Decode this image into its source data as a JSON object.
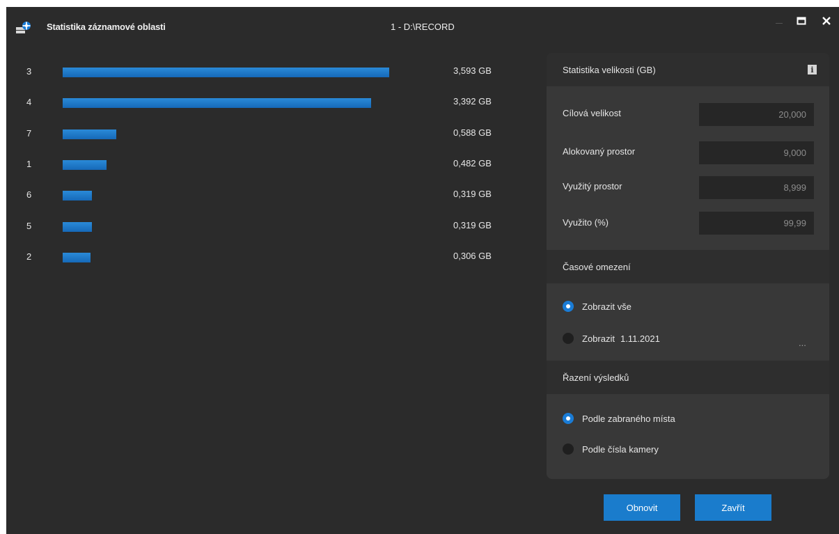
{
  "window": {
    "title": "Statistika záznamové oblasti",
    "subtitle": "1 - D:\\RECORD",
    "icons": [
      "app-icon",
      "minimize-icon",
      "maximize-icon",
      "close-icon"
    ]
  },
  "chart_data": {
    "type": "bar",
    "orientation": "horizontal",
    "categories": [
      "3",
      "4",
      "7",
      "1",
      "6",
      "5",
      "2"
    ],
    "values": [
      3.593,
      3.392,
      0.588,
      0.482,
      0.319,
      0.319,
      0.306
    ],
    "value_labels": [
      "3,593 GB",
      "3,392 GB",
      "0,588 GB",
      "0,482 GB",
      "0,319 GB",
      "0,319 GB",
      "0,306 GB"
    ],
    "unit": "GB",
    "bar_color": "#1a75c8"
  },
  "stats": {
    "header": "Statistika velikosti (GB)",
    "fields": [
      {
        "label": "Cílová velikost",
        "value": "20,000"
      },
      {
        "label": "Alokovaný prostor",
        "value": "9,000"
      },
      {
        "label": "Využitý prostor",
        "value": "8,999"
      },
      {
        "label": "Využito (%)",
        "value": "99,99"
      }
    ]
  },
  "time_limit": {
    "header": "Časové omezení",
    "option_all": "Zobrazit vše",
    "option_date": "Zobrazit",
    "date": "1.11.2021",
    "ellipsis": "...",
    "selected": "all"
  },
  "sort": {
    "header": "Řazení výsledků",
    "option_space": "Podle zabraného místa",
    "option_camera": "Podle čísla kamery",
    "selected": "space"
  },
  "buttons": {
    "refresh": "Obnovit",
    "close": "Zavřít"
  },
  "colors": {
    "accent": "#1a7ccc",
    "background": "#2b2b2b",
    "panel": "#383838"
  }
}
